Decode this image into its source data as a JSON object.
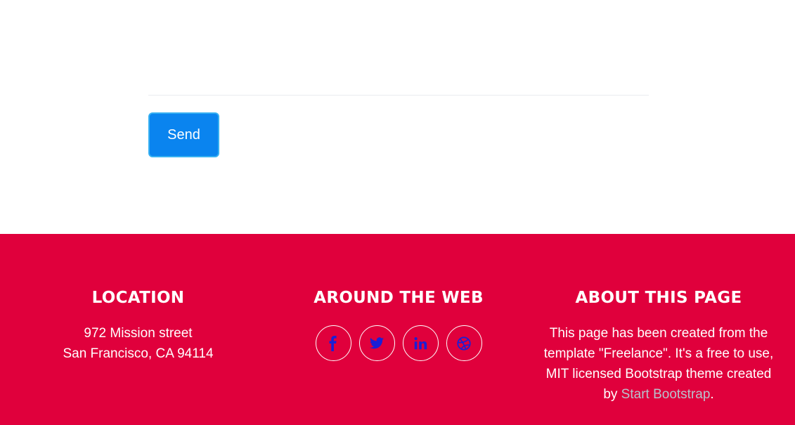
{
  "contact": {
    "send_label": "Send"
  },
  "footer": {
    "location": {
      "heading": "LOCATION",
      "line1": "972 Mission street",
      "line2": "San Francisco, CA 94114"
    },
    "web": {
      "heading": "AROUND THE WEB",
      "icons": [
        "facebook-icon",
        "twitter-icon",
        "linkedin-icon",
        "dribbble-icon"
      ]
    },
    "about": {
      "heading": "ABOUT THIS PAGE",
      "text_before": "This page has been created from the template \"Freelance\". It's a free to use, MIT licensed Bootstrap theme created by ",
      "link_text": "Start Bootstrap",
      "text_after": "."
    }
  },
  "colors": {
    "footer_bg": "#e0003c",
    "send_button_bg": "#0a84ef",
    "icon_color": "#1a1fd6",
    "link_color": "#b8c2cc"
  }
}
